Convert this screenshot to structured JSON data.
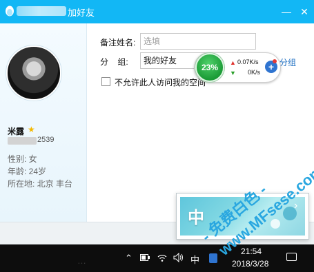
{
  "window": {
    "title_suffix": "加好友",
    "minimize_icon": "minimize-icon",
    "close_icon": "close-icon"
  },
  "profile": {
    "nickname": "米露",
    "uin_partial": "2539",
    "gender": "性别: 女",
    "age": "年龄: 24岁",
    "location": "所在地: 北京  丰台"
  },
  "form": {
    "remark_label": "备注姓名:",
    "remark_placeholder": "选填",
    "group_label": "分    组:",
    "group_value": "我的好友",
    "add_group_link": "分组",
    "checkbox_label": "不允许此人访问我的空间"
  },
  "speed_widget": {
    "percent": "23%",
    "upload": "0.07K/s",
    "download": "0K/s"
  },
  "ime_popup": {
    "char": "中"
  },
  "watermark": {
    "text": "- 免费白色 -",
    "url": "www.MFsese.com"
  },
  "taskbar": {
    "faded_text": "…",
    "ime_indicator": "中",
    "time": "21:54",
    "date": "2018/3/28"
  },
  "colors": {
    "titlebar": "#12b7f5",
    "speed_green": "#1b9b36",
    "link_blue": "#1e6fc2",
    "watermark": "#2aa7e0"
  }
}
